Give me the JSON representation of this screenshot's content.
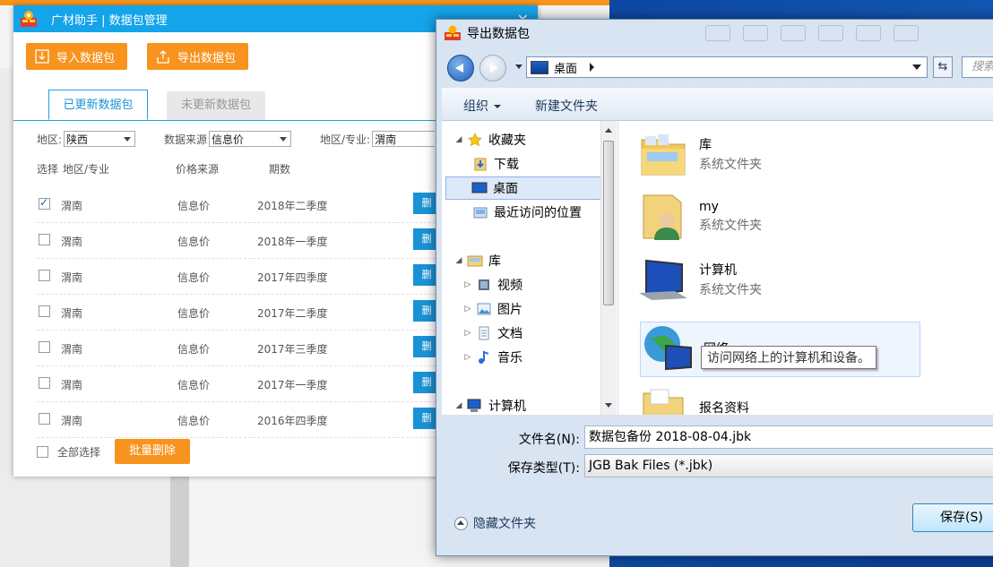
{
  "manager": {
    "title": "广材助手 | 数据包管理",
    "close": "✕",
    "import_label": "导入数据包",
    "export_label": "导出数据包",
    "tabs": {
      "active": "已更新数据包",
      "inactive": "未更新数据包"
    },
    "filters": {
      "region_label": "地区:",
      "region_value": "陕西",
      "source_label": "数据来源",
      "source_value": "信息价",
      "area_label": "地区/专业:",
      "area_value": "渭南"
    },
    "headers": {
      "select": "选择",
      "area": "地区/专业",
      "source": "价格来源",
      "period": "期数"
    },
    "rows": [
      {
        "area": "渭南",
        "source": "信息价",
        "period": "2018年二季度",
        "checked": true
      },
      {
        "area": "渭南",
        "source": "信息价",
        "period": "2018年一季度",
        "checked": false
      },
      {
        "area": "渭南",
        "source": "信息价",
        "period": "2017年四季度",
        "checked": false
      },
      {
        "area": "渭南",
        "source": "信息价",
        "period": "2017年二季度",
        "checked": false
      },
      {
        "area": "渭南",
        "source": "信息价",
        "period": "2017年三季度",
        "checked": false
      },
      {
        "area": "渭南",
        "source": "信息价",
        "period": "2017年一季度",
        "checked": false
      },
      {
        "area": "渭南",
        "source": "信息价",
        "period": "2016年四季度",
        "checked": false
      }
    ],
    "row_button": "删",
    "select_all": "全部选择",
    "batch_delete": "批量删除"
  },
  "dialog": {
    "title": "导出数据包",
    "address": "桌面",
    "search_placeholder": "搜索",
    "toolbar": {
      "organize": "组织",
      "new_folder": "新建文件夹"
    },
    "nav": {
      "favorites": "收藏夹",
      "downloads": "下载",
      "desktop": "桌面",
      "recent": "最近访问的位置",
      "libraries": "库",
      "videos": "视频",
      "pictures": "图片",
      "documents": "文档",
      "music": "音乐",
      "computer": "计算机"
    },
    "files": [
      {
        "name": "库",
        "type": "系统文件夹"
      },
      {
        "name": "my",
        "type": "系统文件夹"
      },
      {
        "name": "计算机",
        "type": "系统文件夹"
      },
      {
        "name": "网络",
        "type": ""
      },
      {
        "name": "报名资料",
        "type": ""
      }
    ],
    "tooltip": "访问网络上的计算机和设备。",
    "filename_label": "文件名(N):",
    "filename_value": "数据包备份 2018-08-04.jbk",
    "filetype_label": "保存类型(T):",
    "filetype_value": "JGB Bak Files (*.jbk)",
    "hide_folders": "隐藏文件夹",
    "save_button": "保存(S)"
  },
  "colors": {
    "accent_blue": "#14a4e9",
    "accent_orange": "#f7931e"
  }
}
